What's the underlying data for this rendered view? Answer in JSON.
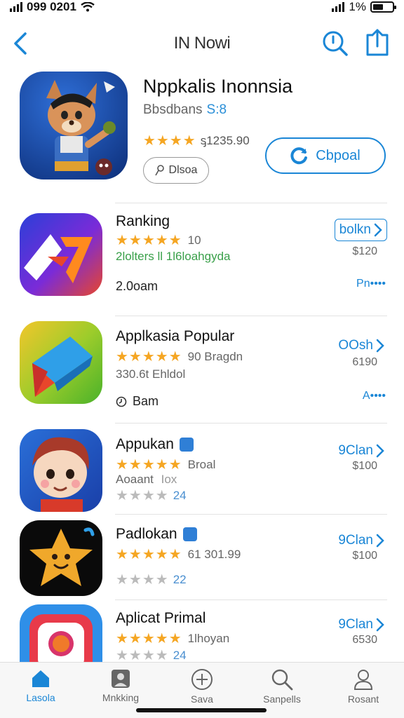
{
  "status_bar": {
    "time": "099 0201",
    "battery_percent": "1%"
  },
  "nav": {
    "title": "IN Nowi"
  },
  "featured": {
    "name": "Nppkalis Inonnsia",
    "subtitle": "Bbsdbans",
    "subtitle_accent": "S:8",
    "stars": "★★★★",
    "rating_text": "ᶊ1235.90",
    "tag_label": "Dlsoa",
    "get_label": "Cbpoal"
  },
  "rows": [
    {
      "name": "Ranking",
      "stars": "★★★★★",
      "rating_text": "10",
      "line3": "2lolters ll 1l6loahgyda",
      "line4": "2.0oam",
      "action": "bolkn",
      "price": "$120",
      "more": "Pn••••"
    },
    {
      "name": "Applkasia Popular",
      "stars": "★★★★★",
      "rating_text": "90 Bragdn",
      "line3": "330.6t Ehldol",
      "line4": "Bam",
      "action": "OOsh",
      "price": "6190",
      "more": "A••••"
    },
    {
      "name": "Appukan",
      "stars": "★★★★★",
      "rating_text": "Broal",
      "line3": "Aoaant",
      "line3_extra": "Iox",
      "gray_stars": "★★★★",
      "gray_value": "24",
      "action": "9Clan",
      "price": "$100"
    },
    {
      "name": "Padlokan",
      "stars": "★★★★★",
      "rating_text": "61 301.99",
      "gray_stars": "★★★★",
      "gray_value": "22",
      "action": "9Clan",
      "price": "$100"
    },
    {
      "name": "Aplicat Primal",
      "stars": "★★★★★",
      "rating_text": "1lhoyan",
      "gray_stars": "★★★★",
      "gray_value": "24",
      "action": "9Clan",
      "price": "6530"
    }
  ],
  "tabs": [
    {
      "label": "Lasola",
      "icon": "home-icon"
    },
    {
      "label": "Mnkking",
      "icon": "person-card-icon"
    },
    {
      "label": "Sava",
      "icon": "plus-circle-icon"
    },
    {
      "label": "Sanpells",
      "icon": "search-icon"
    },
    {
      "label": "Rosant",
      "icon": "profile-icon"
    }
  ]
}
